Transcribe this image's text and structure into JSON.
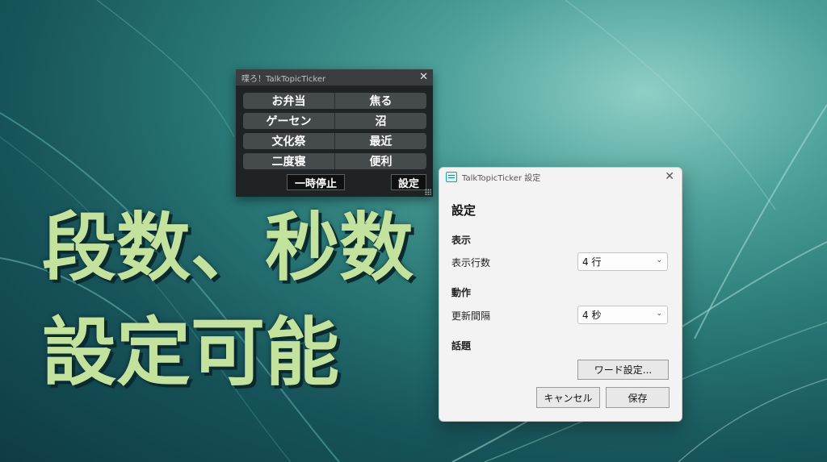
{
  "caption": {
    "line1": "段数、秒数",
    "line2": "設定可能"
  },
  "ticker": {
    "title": "喋ろ！TalkTopicTicker",
    "close_glyph": "✕",
    "rows": [
      {
        "left": "お弁当",
        "right": "焦る"
      },
      {
        "left": "ゲーセン",
        "right": "沼"
      },
      {
        "left": "文化祭",
        "right": "最近"
      },
      {
        "left": "二度寝",
        "right": "便利"
      }
    ],
    "pause_label": "一時停止",
    "settings_label": "設定"
  },
  "dialog": {
    "title": "TalkTopicTicker 設定",
    "close_glyph": "✕",
    "heading": "設定",
    "display_section": "表示",
    "rows_label": "表示行数",
    "rows_value": "4 行",
    "behavior_section": "動作",
    "interval_label": "更新間隔",
    "interval_value": "4 秒",
    "topic_section": "話題",
    "word_button": "ワード設定...",
    "cancel_button": "キャンセル",
    "save_button": "保存",
    "chevron_glyph": "⌄"
  },
  "icons": {
    "app_icon": "ticker-app-icon",
    "close": "close-icon",
    "dropdown": "chevron-down-icon",
    "resize": "resize-grip-icon"
  },
  "colors": {
    "caption_text": "#c3e29e",
    "ticker_bg": "#1f2324",
    "ticker_cell": "#454a4c",
    "dialog_bg": "#f3f3f3",
    "accent": "#1aa3a3"
  }
}
